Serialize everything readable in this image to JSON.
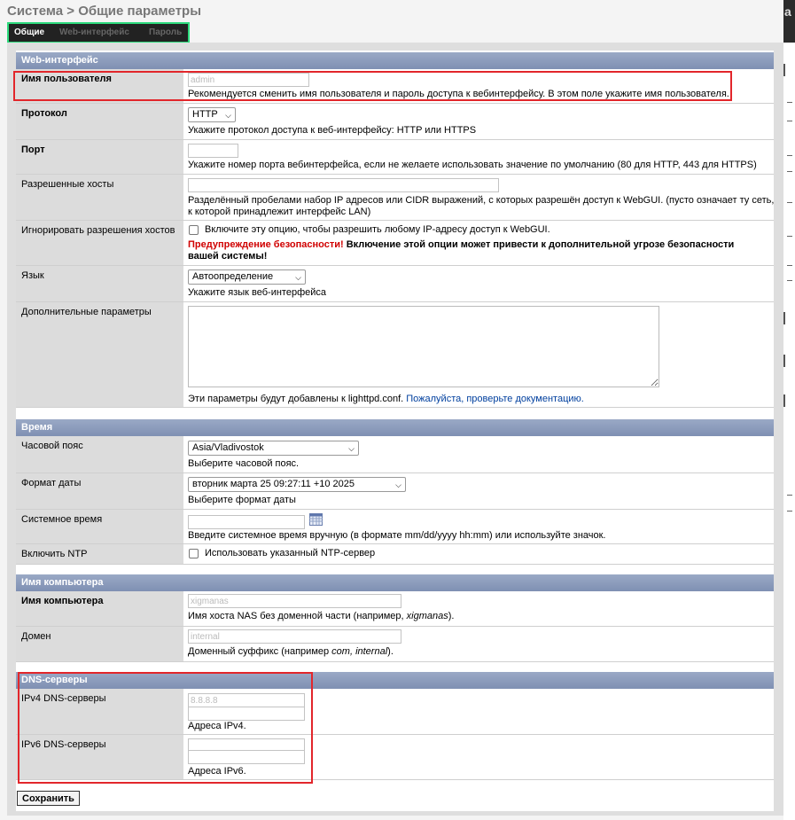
{
  "page_title": "Система > Общие параметры",
  "right_edge_letter": "a",
  "tabs": [
    {
      "label": "Общие",
      "active": true
    },
    {
      "label": "Web-интерфейс",
      "active": false
    },
    {
      "label": "Пароль",
      "active": false
    }
  ],
  "web": {
    "heading": "Web-интерфейс",
    "username": {
      "label": "Имя пользователя",
      "value": "admin",
      "desc": "Рекомендуется сменить имя пользователя и пароль доступа к вебинтерфейсу. В этом поле укажите имя пользователя."
    },
    "protocol": {
      "label": "Протокол",
      "value": "HTTP",
      "desc": "Укажите протокол доступа к веб-интерфейсу: HTTP или HTTPS"
    },
    "port": {
      "label": "Порт",
      "value": "",
      "desc": "Укажите номер порта вебинтерфейса, если не желаете использовать значение по умолчанию (80 для HTTP, 443 для HTTPS)"
    },
    "allowed_hosts": {
      "label": "Разрешенные хосты",
      "value": "",
      "desc_line1": "Разделённый пробелами набор IP адресов или CIDR выражений, с которых разрешён доступ к WebGUI. (пусто означает ту сеть,",
      "desc_line2": "к которой принадлежит интерфейс LAN)"
    },
    "ignore_hosts": {
      "label": "Игнорировать разрешения хостов",
      "checkbox_text": "Включите эту опцию, чтобы разрешить любому IP-адресу доступ к WebGUI.",
      "warn_red": "Предупреждение безопасности!",
      "warn_text1": "Включение этой опции может привести к дополнительной угрозе безопасности",
      "warn_text2": "вашей системы!"
    },
    "language": {
      "label": "Язык",
      "value": "Автоопределение",
      "desc": "Укажите язык веб-интерфейса"
    },
    "extra": {
      "label": "Дополнительные параметры",
      "desc": "Эти параметры будут добавлены к lighttpd.conf.",
      "link": "Пожалуйста, проверьте документацию."
    }
  },
  "time": {
    "heading": "Время",
    "timezone": {
      "label": "Часовой пояс",
      "value": "Asia/Vladivostok",
      "desc": "Выберите часовой пояс."
    },
    "date_format": {
      "label": "Формат даты",
      "value": "вторник марта 25 09:27:11 +10 2025",
      "desc": "Выберите формат даты"
    },
    "system_time": {
      "label": "Системное время",
      "value": "",
      "desc": "Введите системное время вручную (в формате mm/dd/yyyy hh:mm) или используйте значок."
    },
    "ntp": {
      "label": "Включить NTP",
      "checkbox_text": "Использовать указанный NTP-сервер"
    }
  },
  "hostname": {
    "heading": "Имя компьютера",
    "name": {
      "label": "Имя компьютера",
      "value": "xigmanas",
      "desc_prefix": "Имя хоста NAS без доменной части (например, ",
      "desc_example": "xigmanas",
      "desc_suffix": ")."
    },
    "domain": {
      "label": "Домен",
      "value": "internal",
      "desc_prefix": "Доменный суффикс (например ",
      "desc_example": "com, internal",
      "desc_suffix": ")."
    }
  },
  "dns": {
    "heading": "DNS-серверы",
    "ipv4": {
      "label": "IPv4 DNS-серверы",
      "value1": "8.8.8.8",
      "value2": "",
      "desc": "Адреса IPv4."
    },
    "ipv6": {
      "label": "IPv6 DNS-серверы",
      "value1": "",
      "value2": "",
      "desc": "Адреса IPv6."
    }
  },
  "save_label": "Сохранить",
  "colors": {
    "accent_green": "#2ddb7d",
    "highlight_red": "#e2262b",
    "section_header": "#8797ba",
    "label_bg": "#dcdcdc"
  }
}
